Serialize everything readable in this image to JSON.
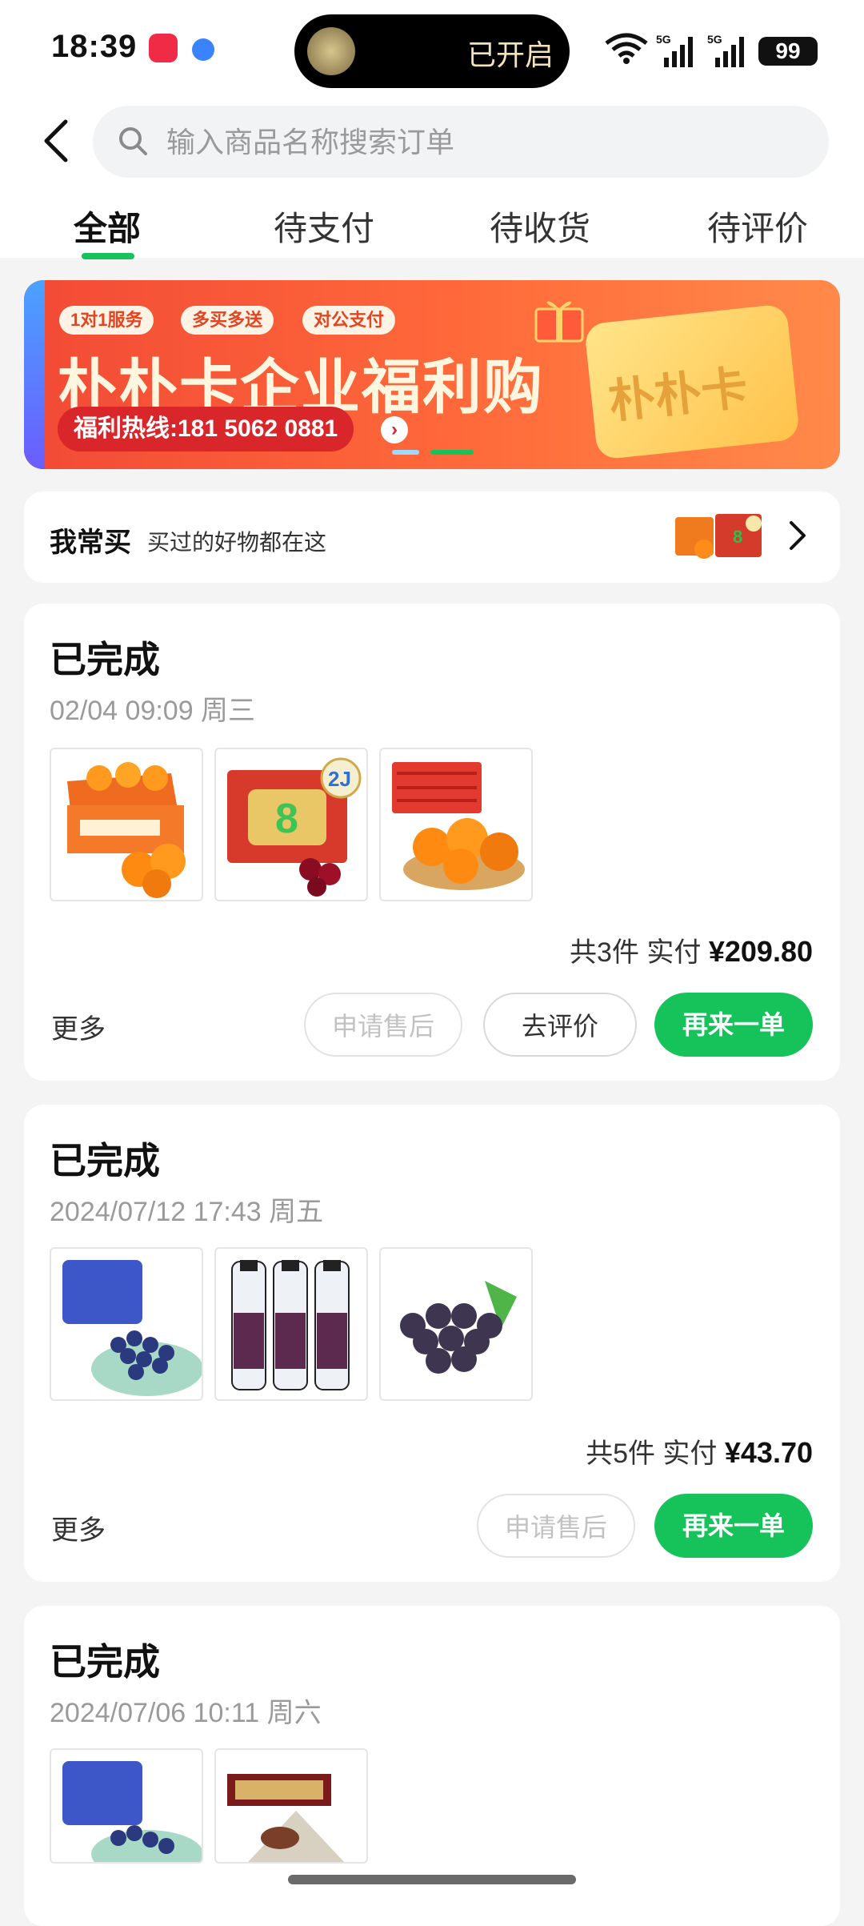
{
  "status_bar": {
    "time": "18:39",
    "island_text": "已开启",
    "battery": "99",
    "icons": [
      "app-icon",
      "app-icon",
      "flashlight-icon",
      "wifi-icon",
      "signal-5g-icon",
      "signal-5g-icon",
      "battery-icon"
    ]
  },
  "header": {
    "back_icon": "chevron-left-icon",
    "search_placeholder": "输入商品名称搜索订单",
    "tabs": [
      {
        "label": "全部",
        "active": true
      },
      {
        "label": "待支付",
        "active": false
      },
      {
        "label": "待收货",
        "active": false
      },
      {
        "label": "待评价",
        "active": false
      }
    ]
  },
  "banner": {
    "tags": [
      "1对1服务",
      "多买多送",
      "对公支付"
    ],
    "title": "朴朴卡企业福利购",
    "hotline": "福利热线:181 5062 0881",
    "card_text": "朴朴卡"
  },
  "frequent": {
    "title": "我常买",
    "subtitle": "买过的好物都在这"
  },
  "orders": [
    {
      "status": "已完成",
      "date": "02/04 09:09 周三",
      "items": [
        "orange-box",
        "cherry-box",
        "orange-basket"
      ],
      "total_prefix": "共3件 实付",
      "amount": "¥209.80",
      "more": "更多",
      "buttons": {
        "aftersale": "申请售后",
        "review": "去评价",
        "reorder": "再来一单"
      }
    },
    {
      "status": "已完成",
      "date": "2024/07/12 17:43 周五",
      "items": [
        "blueberries",
        "drink-bottles",
        "grapes"
      ],
      "total_prefix": "共5件 实付",
      "amount": "¥43.70",
      "more": "更多",
      "buttons": {
        "aftersale": "申请售后",
        "reorder": "再来一单"
      }
    },
    {
      "status": "已完成",
      "date": "2024/07/06 10:11 周六",
      "items": [
        "blueberries",
        "red-bean-zongzi"
      ]
    }
  ],
  "colors": {
    "accent_green": "#16c35a",
    "banner_red": "#f24a36"
  }
}
